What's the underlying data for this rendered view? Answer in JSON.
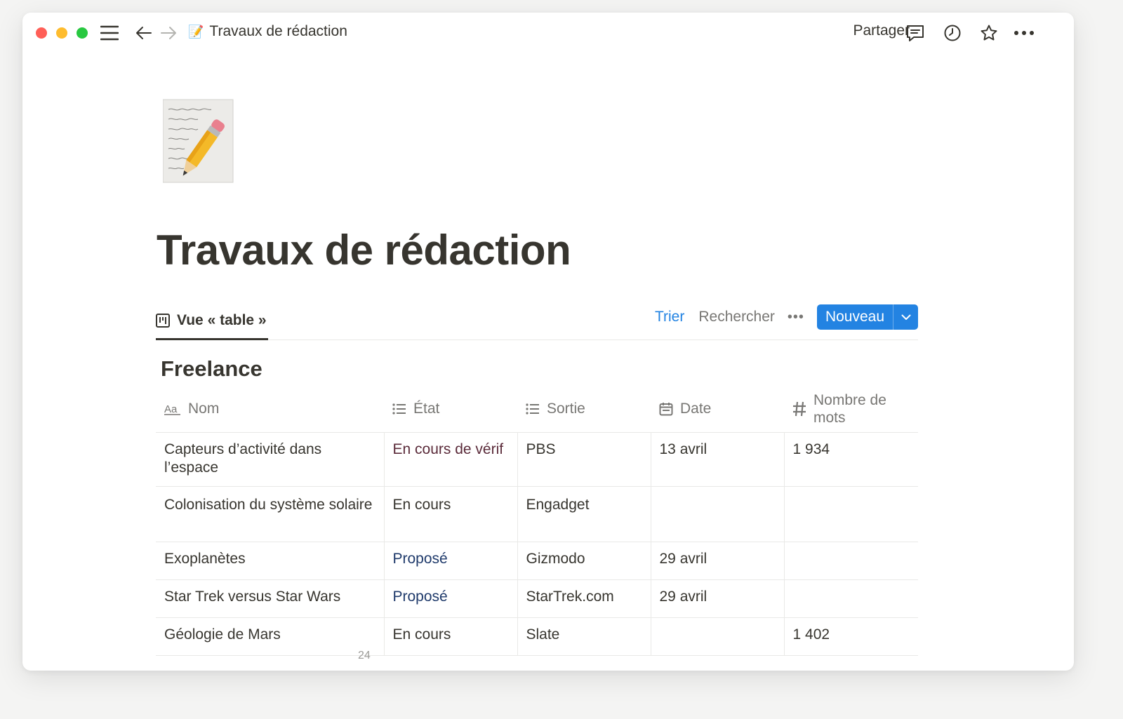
{
  "topbar": {
    "breadcrumb_emoji": "📝",
    "breadcrumb_title": "Travaux de rédaction",
    "share_label": "Partager"
  },
  "page": {
    "title": "Travaux de rédaction"
  },
  "view": {
    "tab_label": "Vue « table »",
    "sort_label": "Trier",
    "search_label": "Rechercher",
    "more_label": "•••",
    "new_label": "Nouveau"
  },
  "group": {
    "title": "Freelance"
  },
  "table": {
    "columns": [
      {
        "label": "Nom",
        "icon": "text-property-icon"
      },
      {
        "label": "État",
        "icon": "list-icon"
      },
      {
        "label": "Sortie",
        "icon": "list-icon"
      },
      {
        "label": "Date",
        "icon": "calendar-icon"
      },
      {
        "label": "Nombre de mots",
        "icon": "number-icon"
      }
    ],
    "rows": [
      {
        "nom": "Capteurs d’activité dans l’espace",
        "etat": "En cours de vérif",
        "sortie": "PBS",
        "date": "13 avril",
        "mots": "1 934"
      },
      {
        "nom": "Colonisation du système solaire",
        "etat": "En cours",
        "sortie": "Engadget",
        "date": "",
        "mots": ""
      },
      {
        "nom": "Exoplanètes",
        "etat": "Proposé",
        "sortie": "Gizmodo",
        "date": "29 avril",
        "mots": ""
      },
      {
        "nom": "Star Trek versus Star Wars",
        "etat": "Proposé",
        "sortie": "StarTrek.com",
        "date": "29 avril",
        "mots": ""
      },
      {
        "nom": "Géologie de Mars",
        "etat": "En cours",
        "sortie": "Slate",
        "date": "",
        "mots": "1 402"
      }
    ],
    "footer_peek": "24"
  },
  "colors": {
    "accent": "#2383e2",
    "state_review": "#5b2b3a",
    "state_proposed": "#1f3a6b",
    "state_in_progress": "#37352f"
  }
}
